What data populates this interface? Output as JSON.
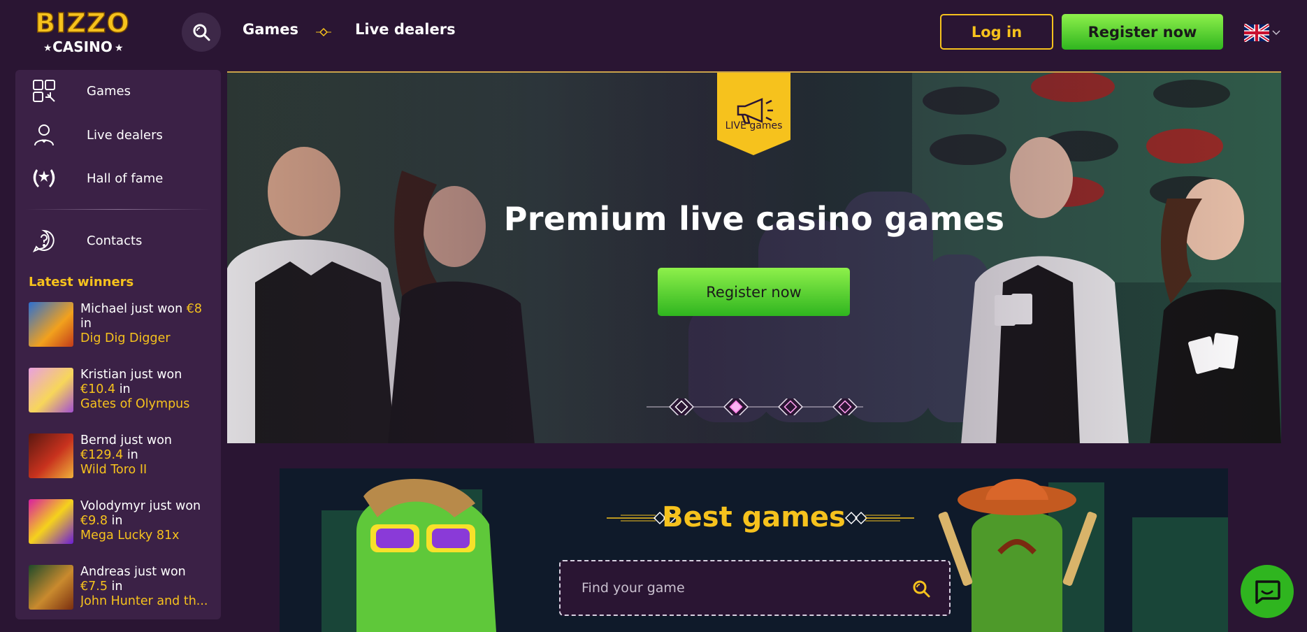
{
  "header": {
    "logo_text_top": "BIZZO",
    "logo_text_bottom": "CASINO",
    "nav": {
      "games": "Games",
      "live_dealers": "Live dealers"
    },
    "login": "Log in",
    "register": "Register now",
    "language_icon": "uk-flag-icon"
  },
  "sidebar": {
    "items": [
      {
        "label": "Games",
        "icon": "puzzle-icon"
      },
      {
        "label": "Live dealers",
        "icon": "dealer-icon"
      },
      {
        "label": "Hall of fame",
        "icon": "laurel-icon"
      },
      {
        "label": "Contacts",
        "icon": "help-icon"
      }
    ],
    "winners_title": "Latest winners",
    "winners": [
      {
        "name": "Michael just won",
        "amount": "€8",
        "in": "in",
        "game": "Dig Dig Digger"
      },
      {
        "name": "Kristian just won",
        "amount": "€10.4",
        "in": "in",
        "game": "Gates of Olympus"
      },
      {
        "name": "Bernd just won",
        "amount": "€129.4",
        "in": "in",
        "game": "Wild Toro II"
      },
      {
        "name": "Volodymyr just won",
        "amount": "€9.8",
        "in": "in",
        "game": "Mega Lucky 81x"
      },
      {
        "name": "Andreas just won",
        "amount": "€7.5",
        "in": "in",
        "game": "John Hunter and th..."
      }
    ]
  },
  "hero": {
    "badge": "LIVE games",
    "title": "Premium live casino games",
    "cta": "Register now",
    "slides_total": 4,
    "active_slide": 2
  },
  "best_games": {
    "title": "Best games",
    "search_placeholder": "Find your game"
  },
  "colors": {
    "background": "#2a1533",
    "sidebar": "#3b2146",
    "accent_yellow": "#f6c21d",
    "accent_green": "#2fb51f"
  }
}
